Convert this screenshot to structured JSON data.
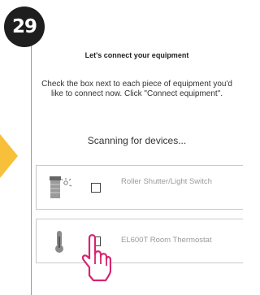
{
  "step": {
    "number": "29"
  },
  "panel": {
    "title": "Let's connect your equipment",
    "instructions": "Check the box next to each piece of equipment you'd like to connect now. Click \"Connect equipment\".",
    "scanning": "Scanning for devices..."
  },
  "devices": [
    {
      "label": "Roller Shutter/Light Switch",
      "icon": "roller-shutter-light-switch-icon",
      "checked": false
    },
    {
      "label": "EL600T Room Thermostat",
      "icon": "thermometer-icon",
      "checked": false
    }
  ],
  "colors": {
    "accent_arrow": "#f8bf3a",
    "cursor": "#d6246e",
    "badge": "#1e1e1e"
  }
}
